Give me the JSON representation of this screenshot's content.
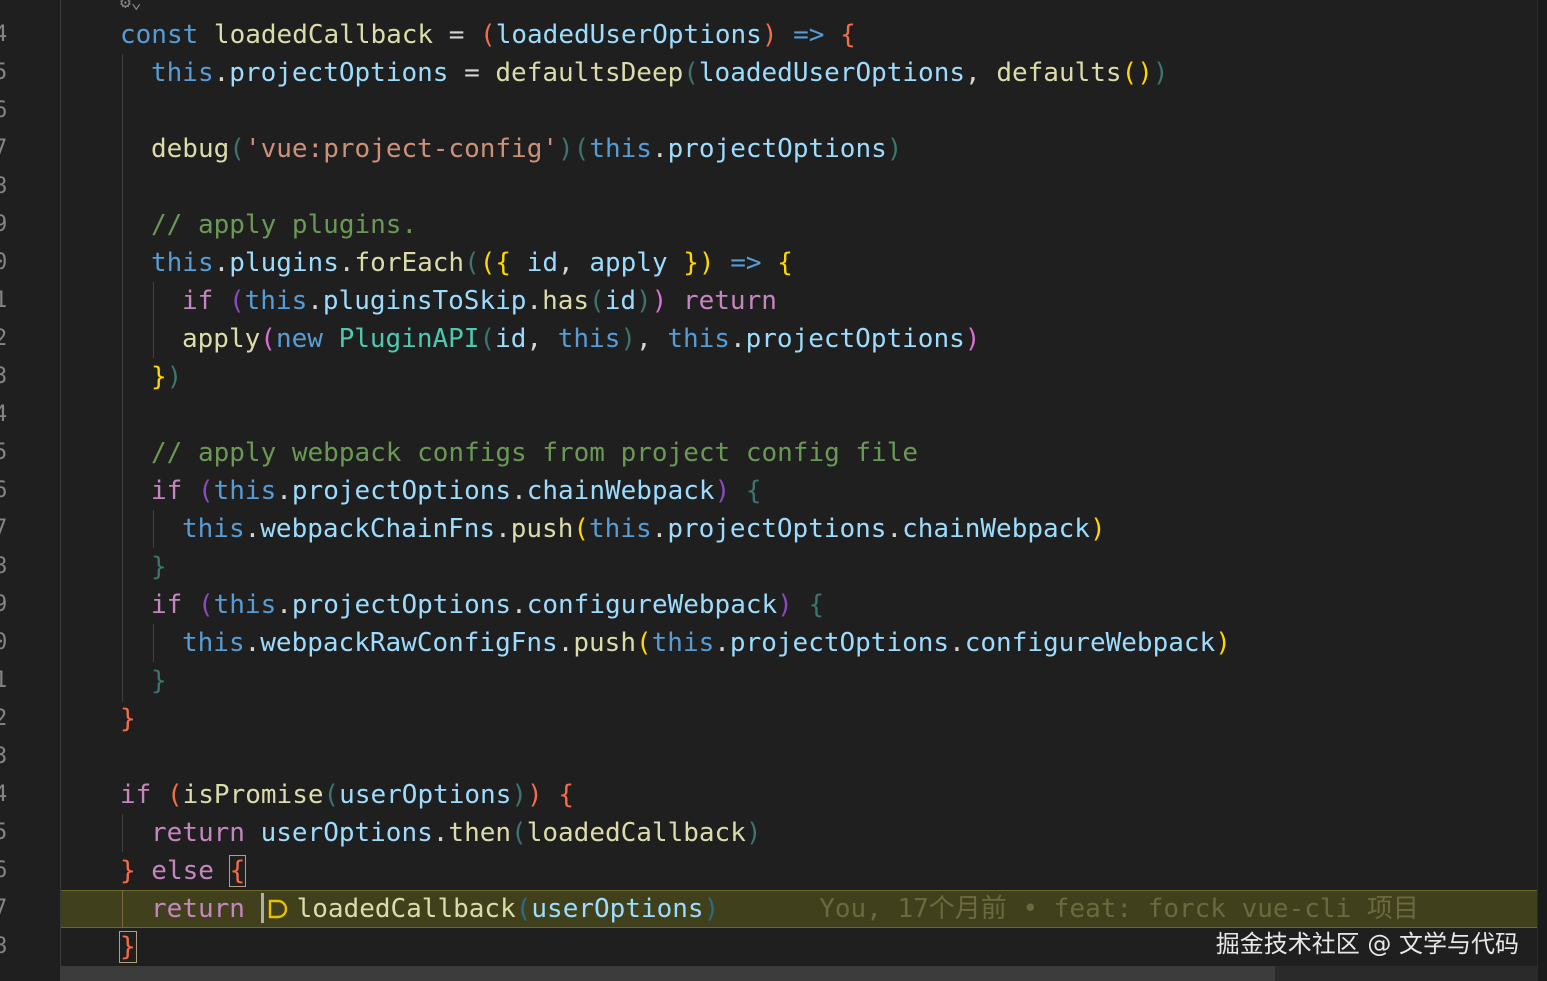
{
  "gutter": {
    "line_numbers": [
      "4",
      "5",
      "6",
      "7",
      "8",
      "9",
      "0",
      "1",
      "2",
      "3",
      "4",
      "5",
      "6",
      "7",
      "8",
      "9",
      "0",
      "1",
      "2",
      "3",
      "4",
      "5",
      "6",
      "7",
      "8"
    ]
  },
  "code": {
    "l1": {
      "a": "const",
      "b": " loadedCallback ",
      "c": "=",
      "d": " ",
      "e": "(",
      "f": "loadedUserOptions",
      "g": ")",
      "h": " => ",
      "i": "{"
    },
    "l2": {
      "a": "this",
      "b": ".",
      "c": "projectOptions",
      "d": " = ",
      "e": "defaultsDeep",
      "f": "(",
      "g": "loadedUserOptions",
      "h": ", ",
      "i": "defaults",
      "j": "()",
      "k": ")"
    },
    "l3": {
      "a": "debug",
      "b": "(",
      "c": "'vue:project-config'",
      "d": ")",
      "e": "(",
      "f": "this",
      "g": ".",
      "h": "projectOptions",
      "i": ")"
    },
    "l4": {
      "a": "// apply plugins."
    },
    "l5": {
      "a": "this",
      "b": ".",
      "c": "plugins",
      "d": ".",
      "e": "forEach",
      "f": "(",
      "g": "({",
      "h": " id",
      "i": ",",
      "j": " apply ",
      "k": "})",
      "l": " => ",
      "m": "{"
    },
    "l6": {
      "a": "if",
      "b": " (",
      "c": "this",
      "d": ".",
      "e": "pluginsToSkip",
      "f": ".",
      "g": "has",
      "h": "(",
      "i": "id",
      "j": ")",
      "k": ")",
      "l": " return"
    },
    "l7": {
      "a": "apply",
      "b": "(",
      "c": "new",
      "d": " ",
      "e": "PluginAPI",
      "f": "(",
      "g": "id",
      "h": ", ",
      "i": "this",
      "j": ")",
      "k": ", ",
      "l": "this",
      "m": ".",
      "n": "projectOptions",
      "o": ")"
    },
    "l8": {
      "a": "}",
      "b": ")"
    },
    "l9": {
      "a": "// apply webpack configs from project config file"
    },
    "l10": {
      "a": "if",
      "b": " (",
      "c": "this",
      "d": ".",
      "e": "projectOptions",
      "f": ".",
      "g": "chainWebpack",
      "h": ")",
      "i": " {"
    },
    "l11": {
      "a": "this",
      "b": ".",
      "c": "webpackChainFns",
      "d": ".",
      "e": "push",
      "f": "(",
      "g": "this",
      "h": ".",
      "i": "projectOptions",
      "j": ".",
      "k": "chainWebpack",
      "l": ")"
    },
    "l12": {
      "a": "}"
    },
    "l13": {
      "a": "if",
      "b": " (",
      "c": "this",
      "d": ".",
      "e": "projectOptions",
      "f": ".",
      "g": "configureWebpack",
      "h": ")",
      "i": " {"
    },
    "l14": {
      "a": "this",
      "b": ".",
      "c": "webpackRawConfigFns",
      "d": ".",
      "e": "push",
      "f": "(",
      "g": "this",
      "h": ".",
      "i": "projectOptions",
      "j": ".",
      "k": "configureWebpack",
      "l": ")"
    },
    "l15": {
      "a": "}"
    },
    "l16": {
      "a": "}"
    },
    "l17": {
      "a": "if",
      "b": " (",
      "c": "isPromise",
      "d": "(",
      "e": "userOptions",
      "f": ")",
      "g": ")",
      "h": " {"
    },
    "l18": {
      "a": "return",
      "b": " ",
      "c": "userOptions",
      "d": ".",
      "e": "then",
      "f": "(",
      "g": "loadedCallback",
      "h": ")"
    },
    "l19": {
      "a": "}",
      "b": " else ",
      "c": "{"
    },
    "l20": {
      "a": "return",
      "b": " ",
      "c": "loadedCallback",
      "d": "(",
      "e": "userOptions",
      "f": ")"
    },
    "l21": {
      "a": "}"
    }
  },
  "blame": "You, 17个月前 • feat: forck vue-cli 项目",
  "watermark": "掘金技术社区 @ 文学与代码",
  "icons": [
    "lightbulb-icon",
    "source-control-icon"
  ],
  "colors": {
    "background": "#1f1f1f",
    "current_line": "#41401c",
    "keyword": "#569cd6",
    "control": "#c586c0",
    "function": "#dcdcaa",
    "variable": "#9cdcfe",
    "type": "#4ec9b0",
    "string": "#ce9178",
    "comment": "#6a9955"
  }
}
